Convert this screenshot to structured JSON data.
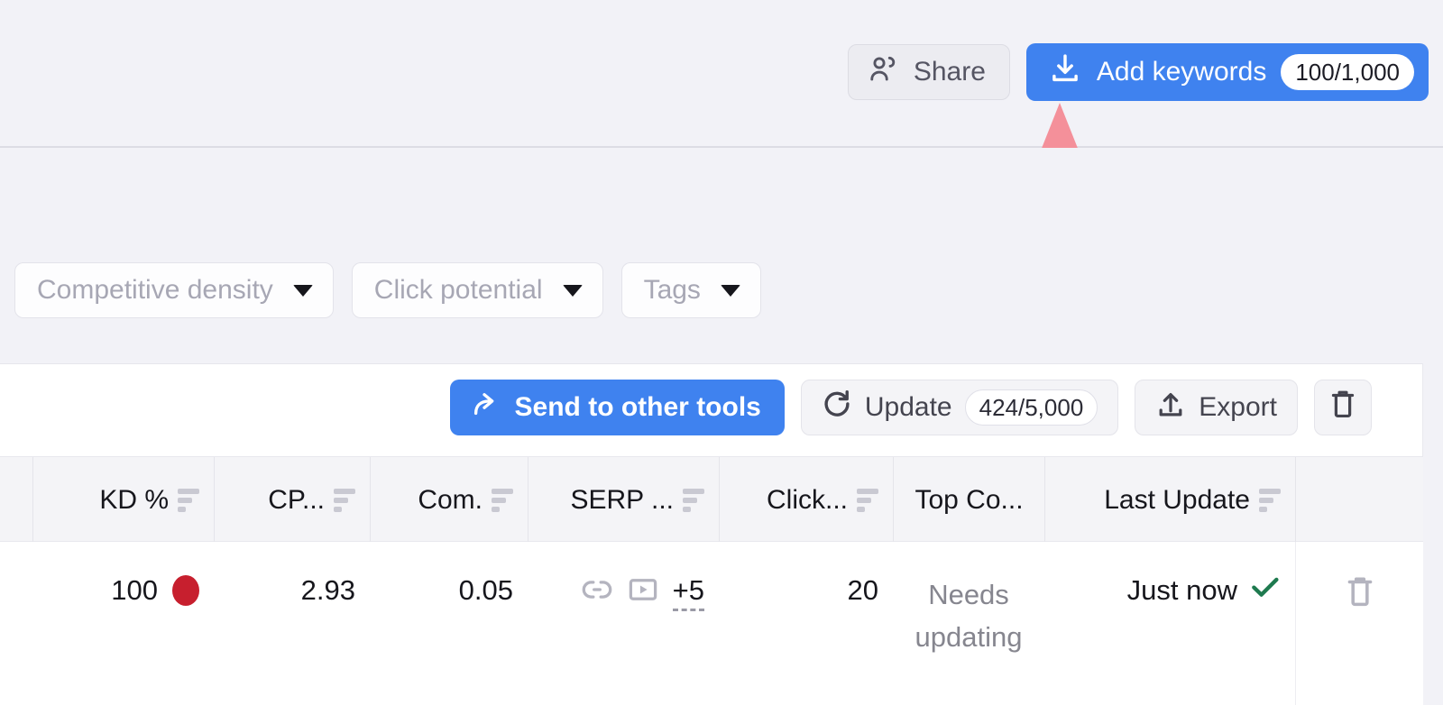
{
  "header": {
    "share": {
      "label": "Share",
      "icon": "users-icon"
    },
    "add_keywords": {
      "label": "Add keywords",
      "count": "100/1,000",
      "icon": "download-icon",
      "color": "#3f82ef"
    }
  },
  "annotation": {
    "type": "curved-arrow",
    "color": "#f4909a",
    "points_to": "Add keywords"
  },
  "filters": [
    {
      "label": "Competitive density",
      "icon": "chevron-down-icon"
    },
    {
      "label": "Click potential",
      "icon": "chevron-down-icon"
    },
    {
      "label": "Tags",
      "icon": "chevron-down-icon"
    }
  ],
  "toolbar": {
    "send_to_other_tools": {
      "label": "Send to other tools",
      "icon": "share-arrow-icon"
    },
    "update": {
      "label": "Update",
      "count": "424/5,000",
      "icon": "refresh-icon"
    },
    "export": {
      "label": "Export",
      "icon": "upload-icon"
    },
    "delete": {
      "label": "",
      "icon": "trash-icon"
    }
  },
  "table": {
    "columns": [
      {
        "label": "KD %",
        "sortable": true
      },
      {
        "label": "CP...",
        "sortable": true
      },
      {
        "label": "Com.",
        "sortable": true
      },
      {
        "label": "SERP ...",
        "sortable": true
      },
      {
        "label": "Click...",
        "sortable": true
      },
      {
        "label": "Top Co...",
        "sortable": false
      },
      {
        "label": "Last Update",
        "sortable": true
      }
    ],
    "rows": [
      {
        "kd": "100",
        "kd_dot_color": "#c71f2e",
        "cpc": "2.93",
        "com": "0.05",
        "serp_features": [
          "link-icon",
          "video-icon"
        ],
        "serp_more": "+5",
        "click_potential": "20",
        "top_competitor": "Needs updating",
        "last_update": "Just now",
        "last_update_status": "check-icon",
        "row_action": "trash-icon"
      }
    ]
  }
}
